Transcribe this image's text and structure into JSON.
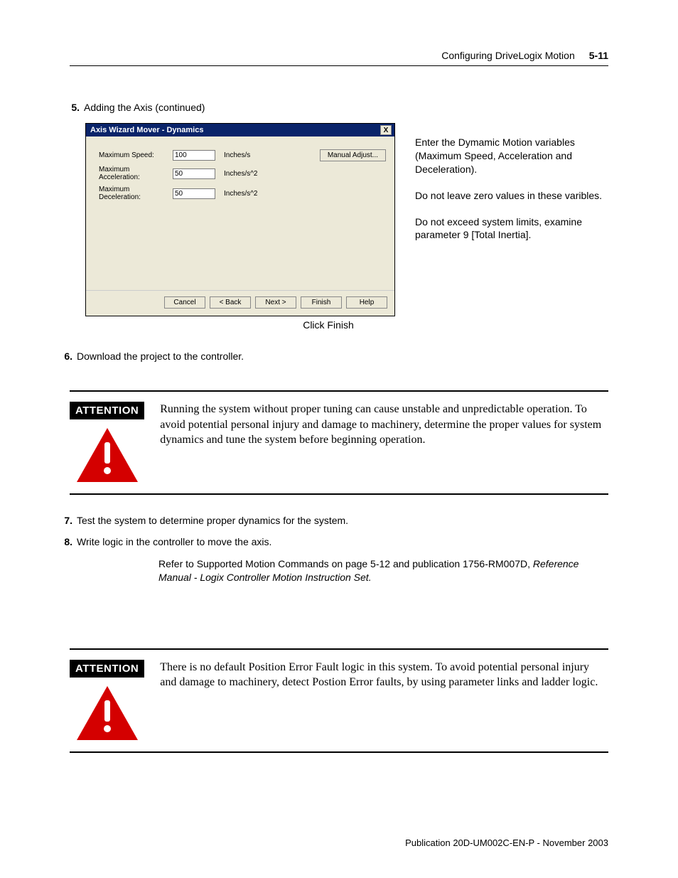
{
  "header": {
    "title": "Configuring DriveLogix Motion",
    "page": "5-11"
  },
  "step5": {
    "num": "5.",
    "text": "Adding the Axis (continued)"
  },
  "dialog": {
    "title": "Axis Wizard Mover - Dynamics",
    "close": "X",
    "fields": {
      "maxSpeed": {
        "label": "Maximum Speed:",
        "value": "100",
        "unit": "Inches/s"
      },
      "maxAccel": {
        "label": "Maximum Acceleration:",
        "value": "50",
        "unit": "Inches/s^2"
      },
      "maxDecel": {
        "label": "Maximum Deceleration:",
        "value": "50",
        "unit": "Inches/s^2"
      }
    },
    "manualAdjust": "Manual Adjust...",
    "buttons": {
      "cancel": "Cancel",
      "back": "< Back",
      "next": "Next >",
      "finish": "Finish",
      "help": "Help"
    }
  },
  "clickFinish": "Click Finish",
  "sideText": {
    "p1": "Enter the Dymamic Motion variables (Maximum Speed, Acceleration and Deceleration).",
    "p2": "Do not leave zero values in these varibles.",
    "p3": "Do not exceed system limits, examine parameter 9 [Total Inertia]."
  },
  "step6": {
    "num": "6.",
    "text": "Download the project to the controller."
  },
  "attention1": {
    "label": "ATTENTION",
    "text": "Running the system without proper tuning can cause unstable and unpredictable operation. To avoid potential personal injury and damage to machinery, determine the proper values for system dynamics and tune the system before beginning operation."
  },
  "step7": {
    "num": "7.",
    "text": "Test the system to determine proper dynamics for the system."
  },
  "step8": {
    "num": "8.",
    "text": "Write logic in the controller to move the axis."
  },
  "reference": {
    "line1": "Refer to Supported Motion Commands on page 5-12 and publication 1756-RM007D, ",
    "italic": "Reference Manual - Logix Controller Motion Instruction Set.",
    "tail": ""
  },
  "attention2": {
    "label": "ATTENTION",
    "text": "There is no default Position Error Fault logic in this system. To avoid potential personal injury and damage to machinery, detect Postion Error faults, by using parameter links and ladder logic."
  },
  "footer": "Publication 20D-UM002C-EN-P - November 2003"
}
